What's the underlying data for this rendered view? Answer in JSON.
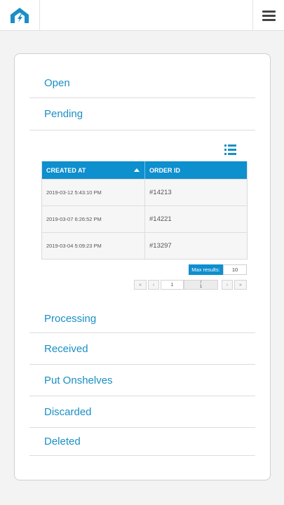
{
  "header": {
    "logo_icon": "app-logo-icon",
    "menu_icon": "hamburger-menu-icon"
  },
  "statuses": {
    "open": "Open",
    "pending": "Pending",
    "processing": "Processing",
    "received": "Received",
    "put_onshelves": "Put Onshelves",
    "discarded": "Discarded",
    "deleted": "Deleted"
  },
  "table": {
    "view_icon": "list-view-icon",
    "columns": [
      "CREATED AT",
      "ORDER ID"
    ],
    "sort_column": "CREATED AT",
    "sort_direction": "ascending",
    "rows": [
      {
        "created_at": "2019-03-12 5:43:10 PM",
        "order_id": "#14213"
      },
      {
        "created_at": "2019-03-07 6:26:52 PM",
        "order_id": "#14221"
      },
      {
        "created_at": "2019-03-04 5:09:23 PM",
        "order_id": "#13297"
      }
    ]
  },
  "pagination": {
    "max_results_label": "Max results:",
    "max_results_value": "10",
    "first": "«",
    "prev": "‹",
    "current_page": "1",
    "total_pages": "1",
    "separator": "/",
    "next": "›",
    "last": "»"
  },
  "colors": {
    "accent": "#1a8fc5",
    "header_blue": "#0e8fce"
  }
}
